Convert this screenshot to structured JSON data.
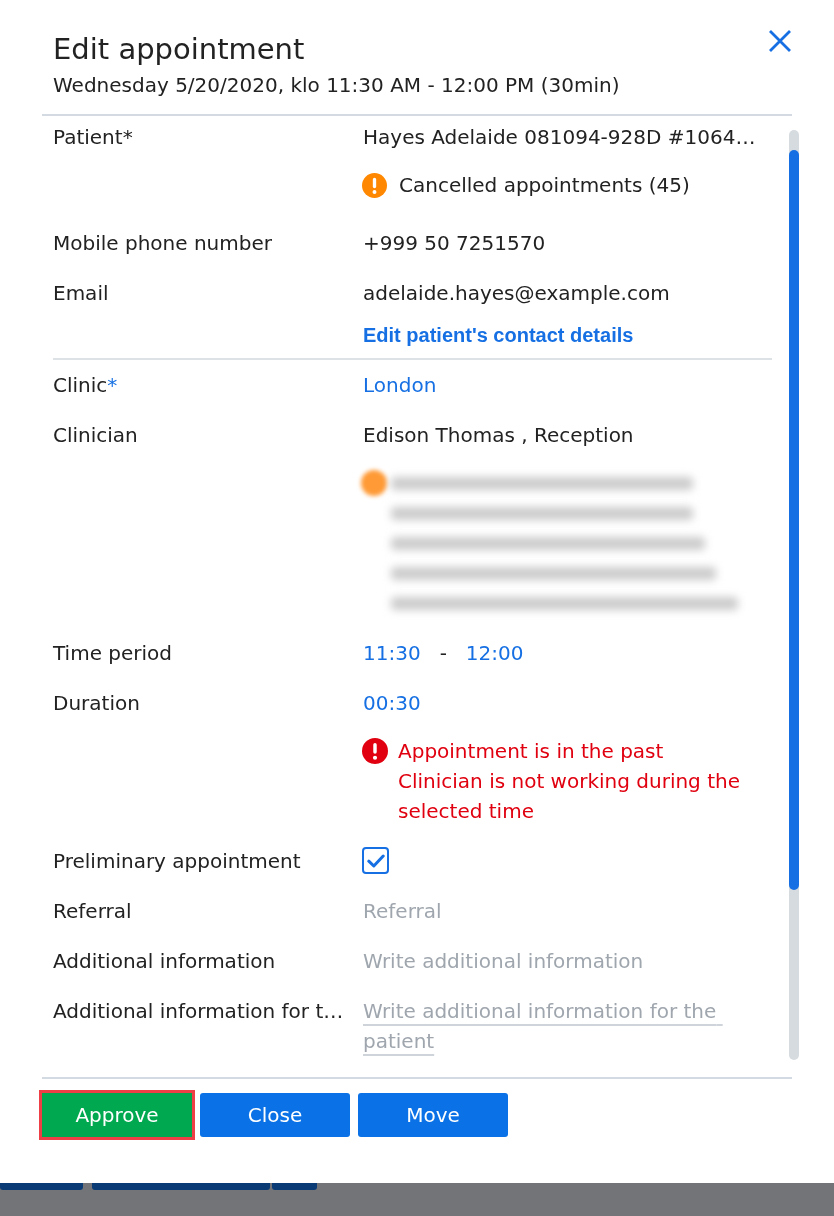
{
  "dialog": {
    "title": "Edit appointment",
    "subtitle": "Wednesday 5/20/2020, klo 11:30 AM - 12:00 PM (30min)"
  },
  "sections": [
    {
      "rows": [
        {
          "kind": "text",
          "label": "Patient*",
          "value": "Hayes Adelaide 081094-928D #1064…"
        },
        {
          "kind": "warning",
          "text": "Cancelled appointments (45)"
        },
        {
          "kind": "text",
          "label": "Mobile phone number",
          "value": "+999 50 7251570"
        },
        {
          "kind": "text",
          "label": "Email",
          "value": "adelaide.hayes@example.com"
        },
        {
          "kind": "link",
          "text": "Edit patient's contact details"
        }
      ]
    },
    {
      "rows": [
        {
          "kind": "select",
          "label": "Clinic",
          "required_mark": "*",
          "value": "London"
        },
        {
          "kind": "text",
          "label": "Clinician",
          "value": "Edison Thomas , Reception"
        },
        {
          "kind": "blurred"
        },
        {
          "kind": "timerange",
          "label": "Time period",
          "start": "11:30",
          "separator": "-",
          "end": "12:00"
        },
        {
          "kind": "select",
          "label": "Duration",
          "value": "00:30"
        },
        {
          "kind": "errors",
          "messages": [
            "Appointment is in the past",
            "Clinician is not working during the selected time"
          ]
        },
        {
          "kind": "checkbox",
          "label": "Preliminary appointment",
          "checked": true
        },
        {
          "kind": "input",
          "label": "Referral",
          "placeholder": "Referral"
        },
        {
          "kind": "input",
          "label": "Additional information",
          "placeholder": "Write additional information"
        },
        {
          "kind": "textarea",
          "label": "Additional information for t…",
          "placeholder": "Write additional information for the patient"
        }
      ]
    }
  ],
  "buttons": [
    {
      "kind": "approve",
      "label": "Approve",
      "highlighted": true
    },
    {
      "kind": "close",
      "label": "Close",
      "highlighted": false
    },
    {
      "kind": "move",
      "label": "Move",
      "highlighted": false
    }
  ]
}
